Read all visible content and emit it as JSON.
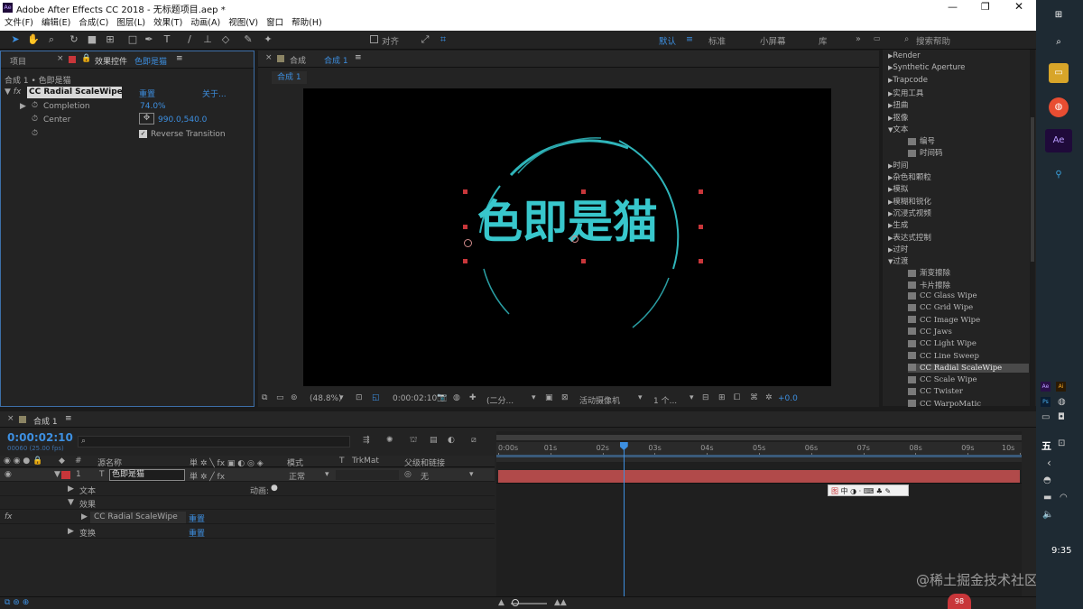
{
  "window": {
    "title": "Adobe After Effects CC 2018 - 无标题项目.aep *",
    "app_badge": "Ae"
  },
  "menu": [
    "文件(F)",
    "编辑(E)",
    "合成(C)",
    "图层(L)",
    "效果(T)",
    "动画(A)",
    "视图(V)",
    "窗口",
    "帮助(H)"
  ],
  "toolbar": {
    "align_label": "对齐",
    "workspaces": [
      "默认",
      "标准",
      "小屏幕",
      "库"
    ],
    "search_placeholder": "搜索帮助",
    "more": "»"
  },
  "project_panel": {
    "tab_project": "项目",
    "tab_effect_controls": "效果控件",
    "layer_name": "色即是猫",
    "breadcrumb": "合成 1 • 色即是猫"
  },
  "effect": {
    "name": "CC Radial ScaleWipe",
    "reset": "重置",
    "about": "关于...",
    "params": [
      {
        "label": "Completion",
        "value": "74.0%"
      },
      {
        "label": "Center",
        "value": "990.0,540.0"
      },
      {
        "label": "",
        "value": "Reverse Transition"
      }
    ]
  },
  "composition": {
    "tab_prefix": "合成",
    "tab_name": "合成 1",
    "subtab": "合成 1",
    "text": "色即是猫"
  },
  "viewer_footer": {
    "zoom": "(48.8%)",
    "timecode": "0:00:02:10",
    "resolution": "(二分...",
    "camera": "活动摄像机",
    "views": "1 个...",
    "exposure": "+0.0"
  },
  "effects_list": {
    "items": [
      {
        "label": "Render",
        "type": "category",
        "open": false
      },
      {
        "label": "Synthetic Aperture",
        "type": "category",
        "open": false
      },
      {
        "label": "Trapcode",
        "type": "category",
        "open": false
      },
      {
        "label": "实用工具",
        "type": "category",
        "open": false
      },
      {
        "label": "扭曲",
        "type": "category",
        "open": false
      },
      {
        "label": "抠像",
        "type": "category",
        "open": false
      },
      {
        "label": "文本",
        "type": "category",
        "open": true
      },
      {
        "label": "编号",
        "type": "effect"
      },
      {
        "label": "时间码",
        "type": "effect"
      },
      {
        "label": "时间",
        "type": "category",
        "open": false
      },
      {
        "label": "杂色和颗粒",
        "type": "category",
        "open": false
      },
      {
        "label": "模拟",
        "type": "category",
        "open": false
      },
      {
        "label": "模糊和锐化",
        "type": "category",
        "open": false
      },
      {
        "label": "沉浸式视频",
        "type": "category",
        "open": false
      },
      {
        "label": "生成",
        "type": "category",
        "open": false
      },
      {
        "label": "表达式控制",
        "type": "category",
        "open": false
      },
      {
        "label": "过时",
        "type": "category",
        "open": false
      },
      {
        "label": "过渡",
        "type": "category",
        "open": true
      },
      {
        "label": "渐变擦除",
        "type": "effect"
      },
      {
        "label": "卡片擦除",
        "type": "effect"
      },
      {
        "label": "CC Glass Wipe",
        "type": "effect"
      },
      {
        "label": "CC Grid Wipe",
        "type": "effect"
      },
      {
        "label": "CC Image Wipe",
        "type": "effect"
      },
      {
        "label": "CC Jaws",
        "type": "effect"
      },
      {
        "label": "CC Light Wipe",
        "type": "effect"
      },
      {
        "label": "CC Line Sweep",
        "type": "effect"
      },
      {
        "label": "CC Radial ScaleWipe",
        "type": "effect",
        "selected": true
      },
      {
        "label": "CC Scale Wipe",
        "type": "effect"
      },
      {
        "label": "CC Twister",
        "type": "effect"
      },
      {
        "label": "CC WarpoMatic",
        "type": "effect"
      }
    ]
  },
  "timeline": {
    "tab": "合成 1",
    "timecode": "0:00:02:10",
    "frames": "00060 (25.00 fps)",
    "columns": {
      "source": "源名称",
      "mode": "模式",
      "t": "T",
      "trkmat": "TrkMat",
      "parent": "父级和链接"
    },
    "layer": {
      "index": "1",
      "type": "T",
      "name": "色即是猫",
      "mode": "正常",
      "parent": "无"
    },
    "sub_rows": {
      "text": "文本",
      "animate": "动画:",
      "effects": "效果",
      "effect_name": "CC Radial ScaleWipe",
      "effect_reset": "重置",
      "transform": "变换",
      "transform_reset": "重置"
    },
    "ruler": [
      "0:00s",
      "01s",
      "02s",
      "03s",
      "04s",
      "05s",
      "06s",
      "07s",
      "08s",
      "09s",
      "10s"
    ],
    "playhead_seconds": 2.4,
    "duration_seconds": 10
  },
  "ime_toolbar": {
    "label": "中"
  },
  "watermark": "@稀土掘金技术社区",
  "badge": "98",
  "taskbar": {
    "clock": "9:35",
    "ime": "五",
    "icons": [
      "Ae",
      "Ps",
      "Ai"
    ]
  },
  "colors": {
    "accent_blue": "#3d8fe0",
    "layer_bar": "#b14a4a",
    "text_cyan": "#38c7cc",
    "handle": "#c8363a"
  }
}
